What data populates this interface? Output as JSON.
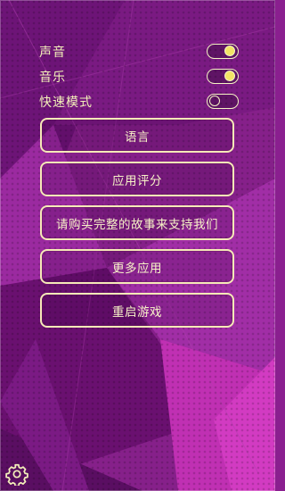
{
  "settings": [
    {
      "label": "声音",
      "state": "on"
    },
    {
      "label": "音乐",
      "state": "on"
    },
    {
      "label": "快速模式",
      "state": "off"
    }
  ],
  "menu": [
    {
      "label": "语言"
    },
    {
      "label": "应用评分"
    },
    {
      "label": "请购买完整的故事来支持我们"
    },
    {
      "label": "更多应用"
    },
    {
      "label": "重启游戏"
    }
  ],
  "colors": {
    "background": "#8a1f8f",
    "accent_text": "#f3f0b9",
    "toggle_knob_on": "#f2e466"
  },
  "icons": {
    "settings": "gear-icon"
  }
}
